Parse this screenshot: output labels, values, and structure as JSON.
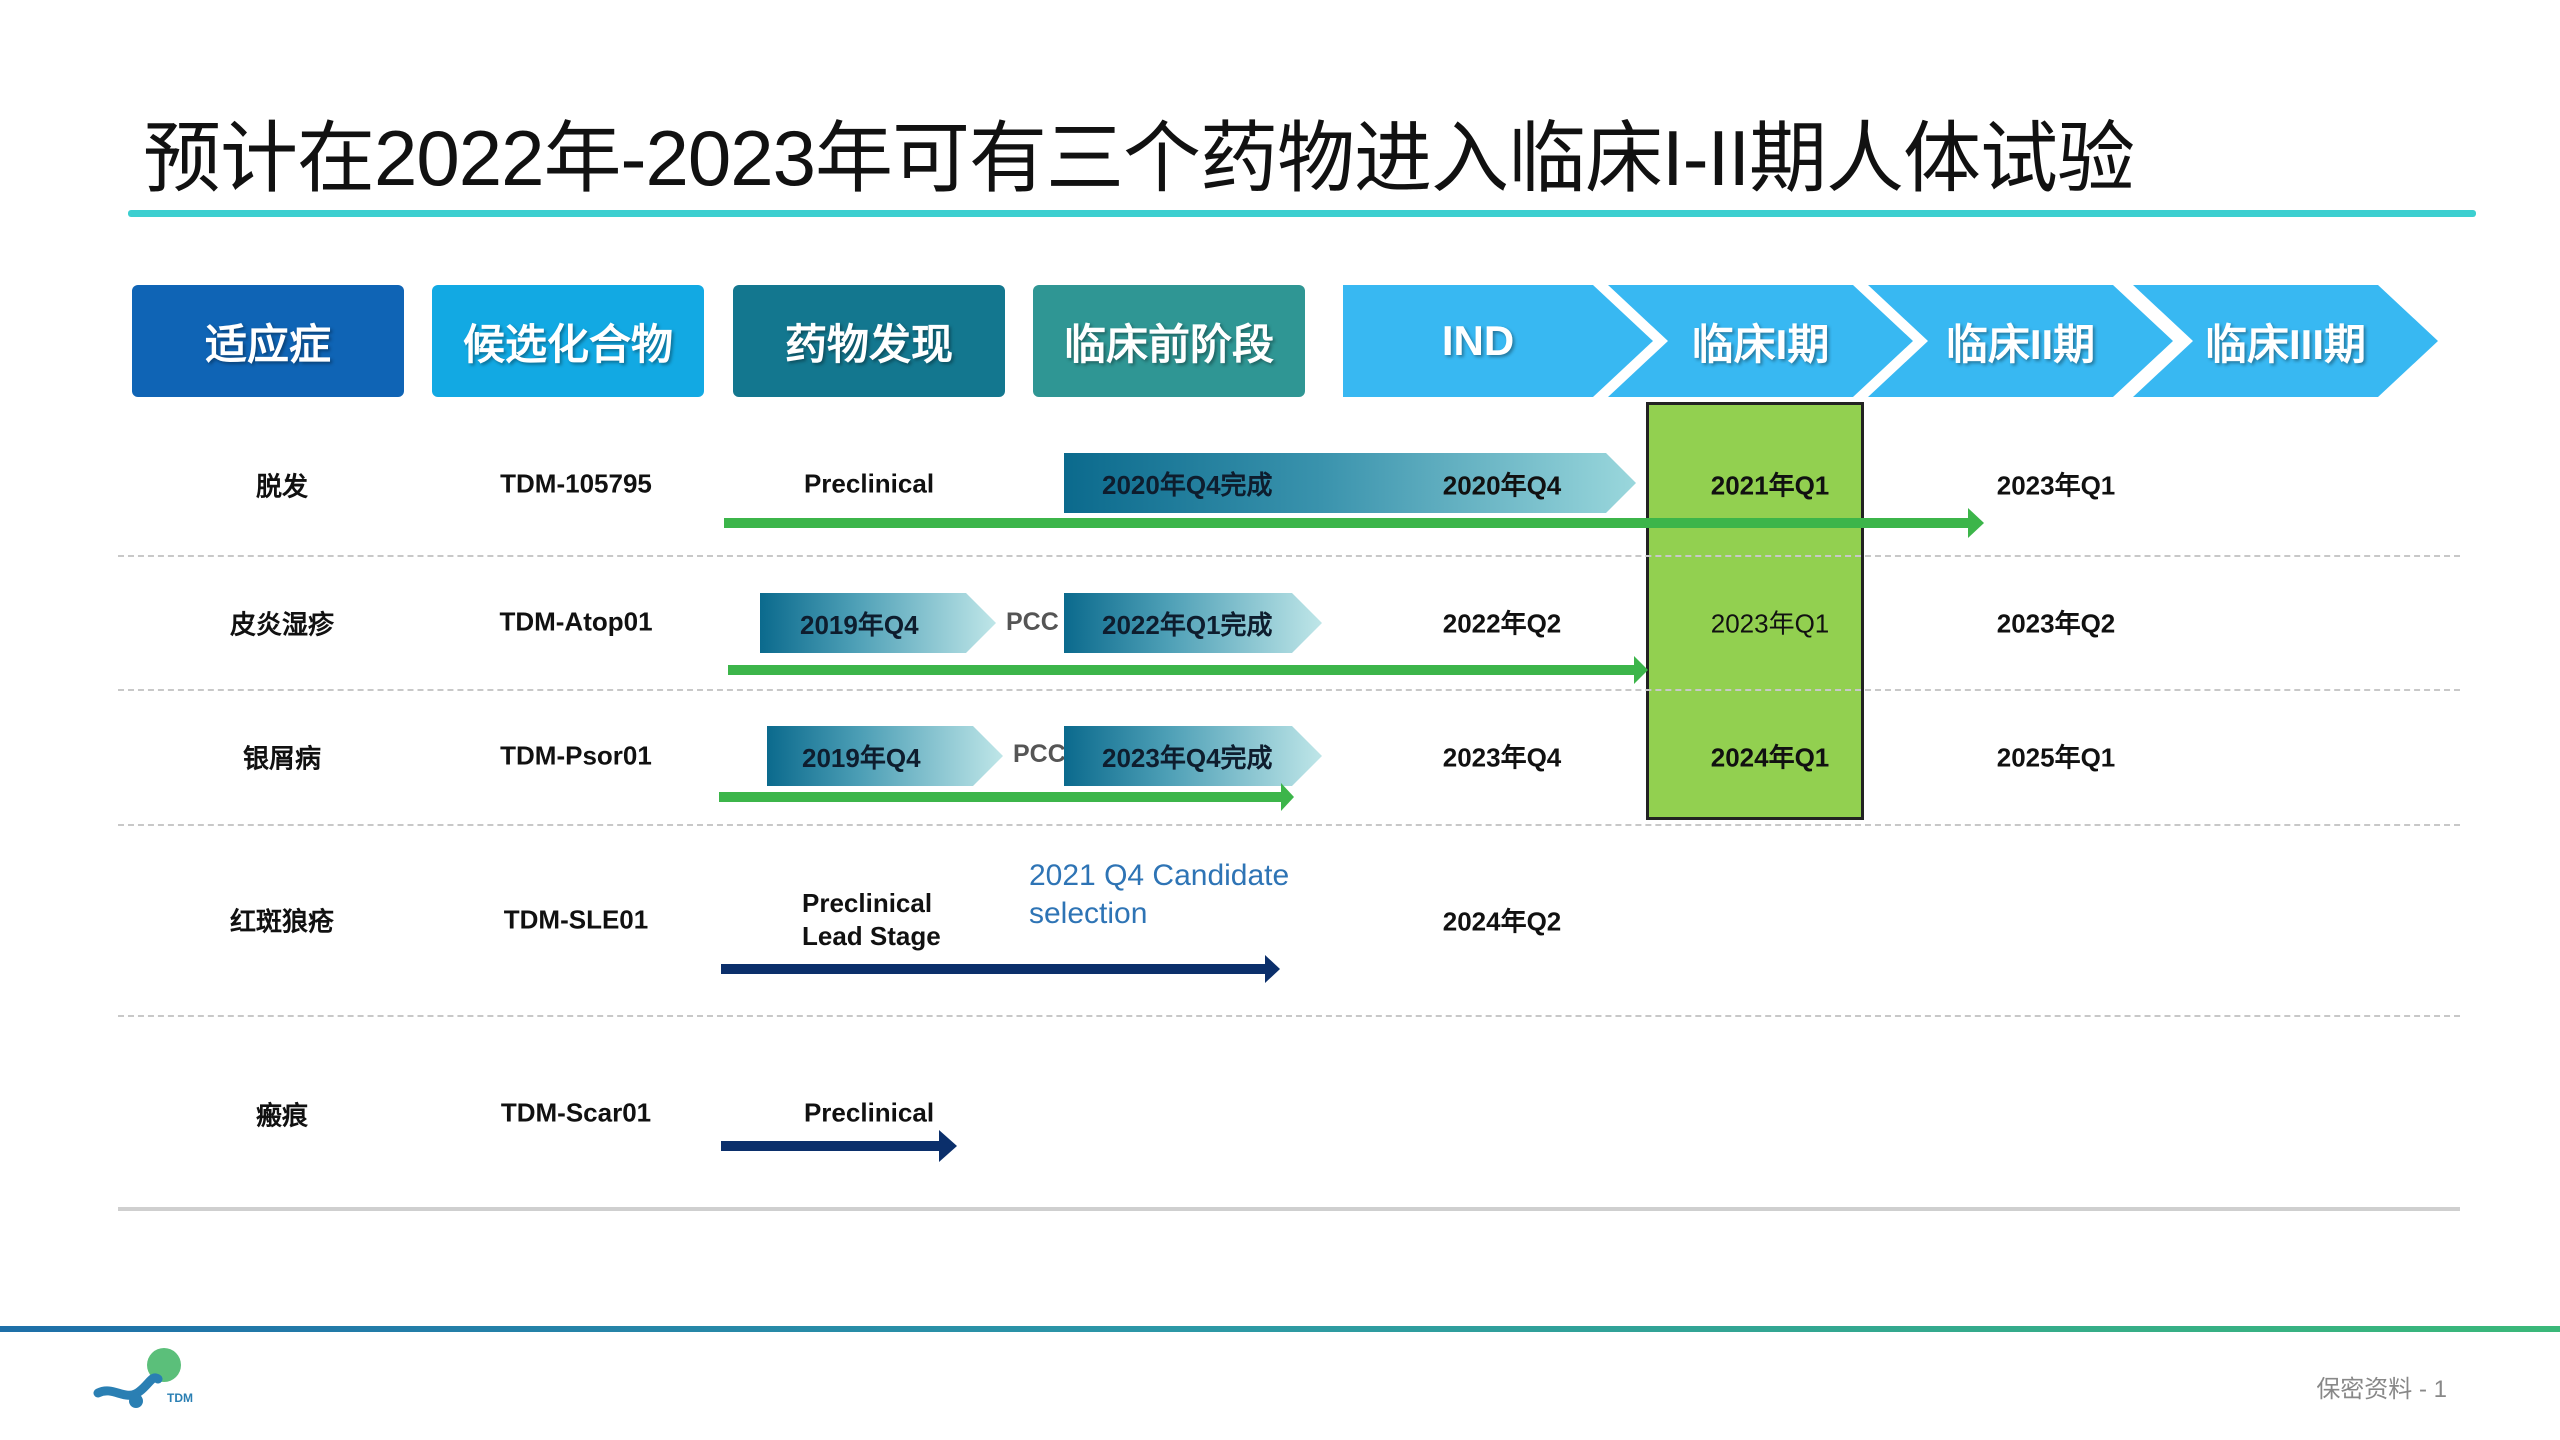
{
  "title": "预计在2022年-2023年可有三个药物进入临床I-II期人体试验",
  "headers": [
    "适应症",
    "候选化合物",
    "药物发现",
    "临床前阶段"
  ],
  "phase_headers": [
    "IND",
    "临床I期",
    "临床II期",
    "临床III期"
  ],
  "rows": [
    {
      "indication": "脱发",
      "compound": "TDM-105795",
      "discovery": "Preclinical",
      "bar": "2020年Q4完成",
      "ind": "2020年Q4",
      "phase1": "2021年Q1",
      "phase2": "2023年Q1"
    },
    {
      "indication": "皮炎湿疹",
      "compound": "TDM-Atop01",
      "discovery_bar": "2019年Q4",
      "pcc": "PCC",
      "bar": "2022年Q1完成",
      "ind": "2022年Q2",
      "phase1": "2023年Q1",
      "phase2": "2023年Q2"
    },
    {
      "indication": "银屑病",
      "compound": "TDM-Psor01",
      "discovery_bar": "2019年Q4",
      "pcc": "PCC",
      "bar": "2023年Q4完成",
      "ind": "2023年Q4",
      "phase1": "2024年Q1",
      "phase2": "2025年Q1"
    },
    {
      "indication": "红斑狼疮",
      "compound": "TDM-SLE01",
      "discovery_line1": "Preclinical",
      "discovery_line2": "Lead Stage",
      "note": "2021 Q4 Candidate selection",
      "ind": "2024年Q2"
    },
    {
      "indication": "瘢痕",
      "compound": "TDM-Scar01",
      "discovery": "Preclinical"
    }
  ],
  "footer": {
    "text": "保密资料 - 1",
    "logo": "TDM"
  },
  "colors": {
    "accent_teal": "#3ccfd0",
    "green": "#3cb54a",
    "navy": "#0b2f6b",
    "highlight": "#92d050"
  }
}
